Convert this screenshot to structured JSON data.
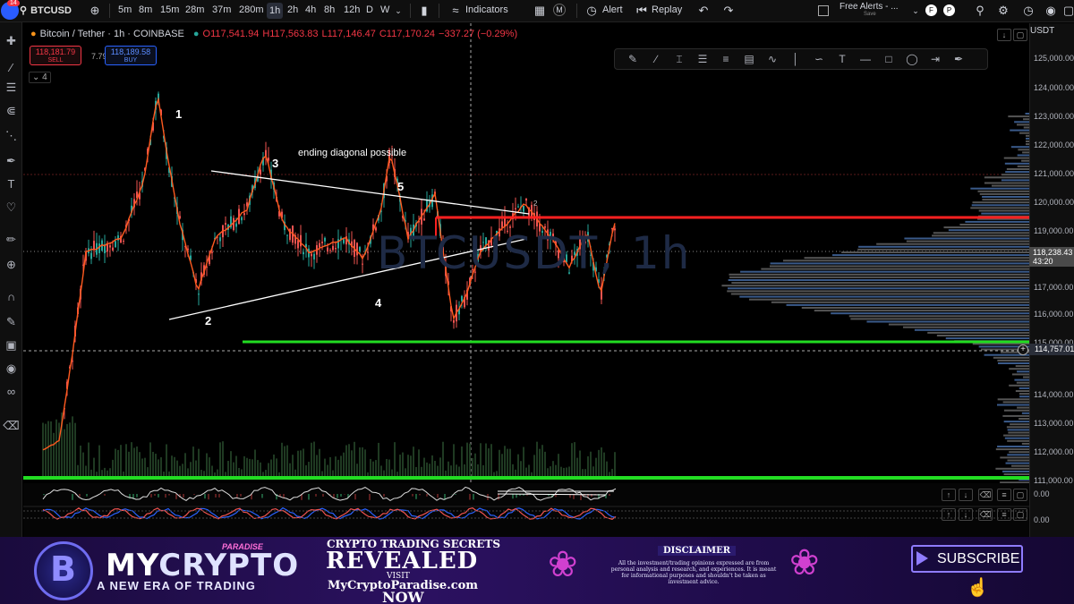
{
  "toolbar": {
    "avatar_badge": "14",
    "symbol": "BTCUSD",
    "intervals": [
      "5m",
      "8m",
      "15m",
      "28m",
      "37m",
      "280m",
      "1h",
      "2h",
      "4h",
      "8h",
      "12h",
      "D",
      "W"
    ],
    "active_interval": "1h",
    "indicators_label": "Indicators",
    "alert_label": "Alert",
    "replay_label": "Replay",
    "free_alerts_label": "Free Alerts - ...",
    "save_label": "Save"
  },
  "legend": {
    "title": "Bitcoin / Tether · 1h · COINBASE",
    "open": "O117,541.94",
    "high": "H117,563.83",
    "low": "L117,146.47",
    "close": "C117,170.24",
    "change": "−337.27 (−0.29%)",
    "sell_price": "118,181.79",
    "sell_label": "SELL",
    "spread": "7.79",
    "buy_price": "118,189.58",
    "buy_label": "BUY",
    "indicator_count": "4"
  },
  "annotations": {
    "wave1": "1",
    "wave2": "2",
    "wave3": "3",
    "wave4": "4",
    "wave5": "5",
    "small2": "2",
    "ending_diagonal": "ending diagonal possible",
    "watermark": "BTCUSDT, 1h"
  },
  "axis": {
    "currency": "USDT",
    "ticks": [
      "125,000.00",
      "124,000.00",
      "123,000.00",
      "122,000.00",
      "121,000.00",
      "120,000.00",
      "119,000.00",
      "118,000.00",
      "117,000.00",
      "116,000.00",
      "115,000.00",
      "114,000.00",
      "113,000.00",
      "112,000.00",
      "111,000.00"
    ],
    "current_price": "118,238.43",
    "countdown": "43:20",
    "crosshair_price": "114,757.01",
    "osc1_value": "0.00",
    "osc2_value": "0.00"
  },
  "banner": {
    "logo_letter": "B",
    "paradise": "PARADISE",
    "brand_my": "MY",
    "brand_crypto": "CRYPTO",
    "tagline": "A NEW ERA OF TRADING",
    "secrets": "CRYPTO TRADING SECRETS",
    "revealed": "REVEALED",
    "visit": "VISIT",
    "url": "MyCryptoParadise.com",
    "now": "NOW",
    "disclaimer_title": "DISCLAIMER",
    "disclaimer_text": "All the investment/trading opinions expressed are from personal analysis and research, and experiences. It is meant for informational purposes and shouldn't be taken as investment advice.",
    "subscribe": "SUBSCRIBE"
  },
  "colors": {
    "up": "#26a69a",
    "down": "#ef5350",
    "ma": "#ff5a1f",
    "support": "#22dd22",
    "resistance": "#ff2020",
    "trendline": "#ffffff"
  },
  "icons": {
    "top": [
      "plus-circle-icon",
      "bar-style-icon",
      "indicators-icon",
      "layout-grid-icon",
      "alert-clock-icon",
      "replay-icon",
      "undo-icon",
      "redo-icon",
      "search-icon",
      "settings-icon",
      "camera-icon",
      "fullscreen-icon"
    ],
    "left": [
      "crosshair-icon",
      "trend-line-icon",
      "horizontal-lines-icon",
      "pitchfork-icon",
      "fib-icon",
      "brush-icon",
      "text-icon",
      "heart-icon",
      "ruler-icon",
      "zoom-icon",
      "magnet-icon",
      "pencil-lock-icon",
      "lock-icon",
      "eye-icon",
      "link-icon",
      "trash-icon"
    ],
    "draw": [
      "pen-icon",
      "line-icon",
      "cursor-text-icon",
      "channel-icon",
      "fib-levels-icon",
      "grid-lines-icon",
      "zigzag-icon",
      "vertical-line-icon",
      "curve-icon",
      "text-tool-icon",
      "horizontal-line-icon",
      "rectangle-icon",
      "circle-icon",
      "measure-icon",
      "brush-tool-icon"
    ]
  }
}
